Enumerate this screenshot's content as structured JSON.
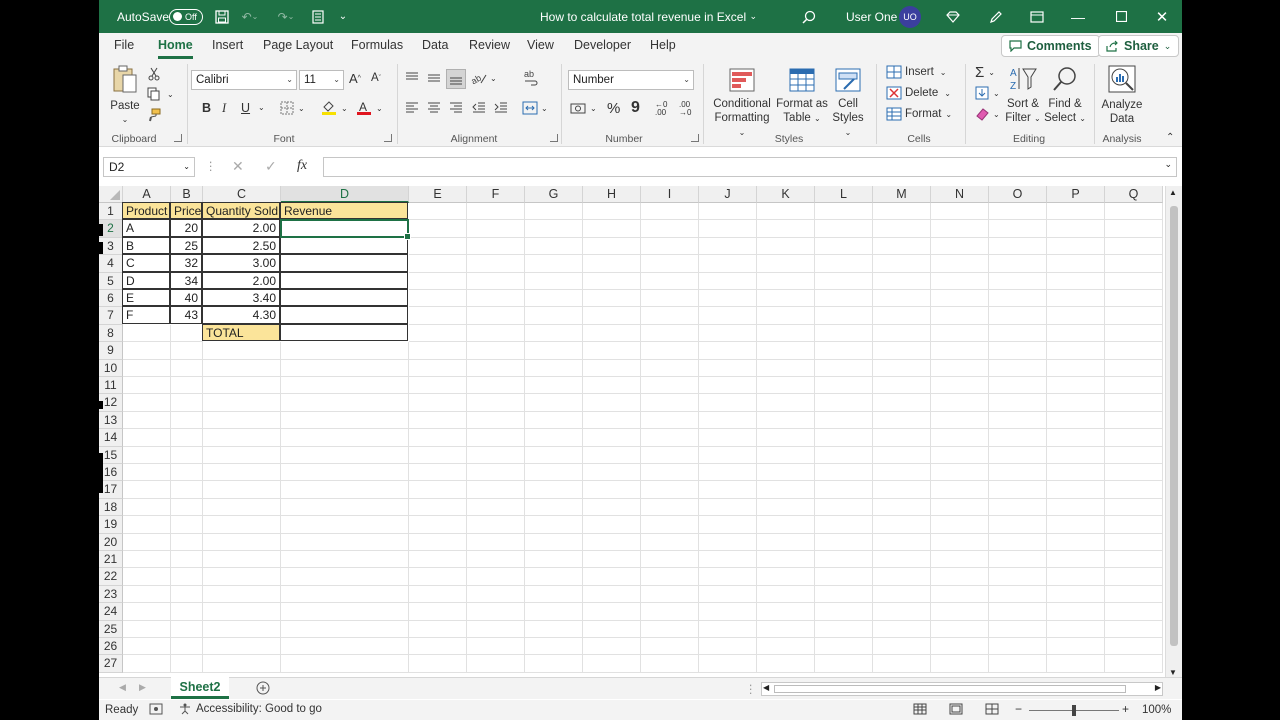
{
  "titlebar": {
    "autosave_label": "AutoSave",
    "autosave_state": "Off",
    "doc_title": "How to calculate total revenue in Excel",
    "user_name": "User One",
    "user_initials": "UO"
  },
  "tabs": [
    "File",
    "Home",
    "Insert",
    "Page Layout",
    "Formulas",
    "Data",
    "Review",
    "View",
    "Developer",
    "Help"
  ],
  "active_tab": "Home",
  "actions": {
    "comments": "Comments",
    "share": "Share"
  },
  "ribbon": {
    "clipboard": {
      "paste": "Paste",
      "label": "Clipboard"
    },
    "font": {
      "name": "Calibri",
      "size": "11",
      "bold": "B",
      "italic": "I",
      "underline": "U",
      "label": "Font"
    },
    "alignment": {
      "label": "Alignment"
    },
    "number": {
      "format": "Number",
      "label": "Number"
    },
    "styles": {
      "conditional": [
        "Conditional",
        "Formatting"
      ],
      "format_table": [
        "Format as",
        "Table"
      ],
      "cell_styles": [
        "Cell",
        "Styles"
      ],
      "label": "Styles"
    },
    "cells": {
      "insert": "Insert",
      "delete": "Delete",
      "format": "Format",
      "label": "Cells"
    },
    "editing": {
      "sort": [
        "Sort &",
        "Filter"
      ],
      "find": [
        "Find &",
        "Select"
      ],
      "label": "Editing"
    },
    "analysis": {
      "analyze": [
        "Analyze",
        "Data"
      ],
      "label": "Analysis"
    }
  },
  "formula_bar": {
    "name_box": "D2",
    "fx": "fx",
    "value": ""
  },
  "columns": [
    "A",
    "B",
    "C",
    "D",
    "E",
    "F",
    "G",
    "H",
    "I",
    "J",
    "K",
    "L",
    "M",
    "N",
    "O",
    "P",
    "Q"
  ],
  "selected_column": "D",
  "rows": [
    "1",
    "2",
    "3",
    "4",
    "5",
    "6",
    "7",
    "8",
    "9",
    "10",
    "11",
    "12",
    "13",
    "14",
    "15",
    "16",
    "17",
    "18",
    "19",
    "20",
    "21",
    "22",
    "23",
    "24",
    "25",
    "26",
    "27"
  ],
  "selected_row": "2",
  "table": {
    "headers": [
      "Product",
      "Price",
      "Quantity Sold",
      "Revenue"
    ],
    "rows": [
      [
        "A",
        "20",
        "2.00",
        ""
      ],
      [
        "B",
        "25",
        "2.50",
        ""
      ],
      [
        "C",
        "32",
        "3.00",
        ""
      ],
      [
        "D",
        "34",
        "2.00",
        ""
      ],
      [
        "E",
        "40",
        "3.40",
        ""
      ],
      [
        "F",
        "43",
        "4.30",
        ""
      ]
    ],
    "total_label": "TOTAL"
  },
  "sheet_tab": "Sheet2",
  "status": {
    "ready": "Ready",
    "accessibility": "Accessibility: Good to go",
    "zoom": "100%"
  }
}
